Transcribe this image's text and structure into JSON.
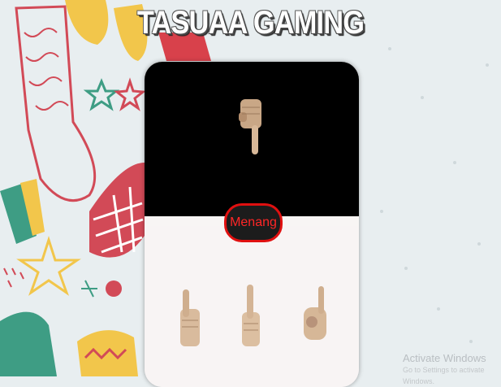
{
  "page": {
    "title": "TASUAA GAMING"
  },
  "computer": {
    "choice_icon": "pointing-down-hand-icon"
  },
  "result": {
    "label": "Menang",
    "color": "#ff2626"
  },
  "player_choices": [
    {
      "icon": "thumb-side-hand-icon"
    },
    {
      "icon": "index-finger-up-hand-icon"
    },
    {
      "icon": "pinky-up-hand-icon"
    }
  ],
  "watermark": {
    "title": "Activate Windows",
    "subtitle": "Go to Settings to activate Windows."
  }
}
